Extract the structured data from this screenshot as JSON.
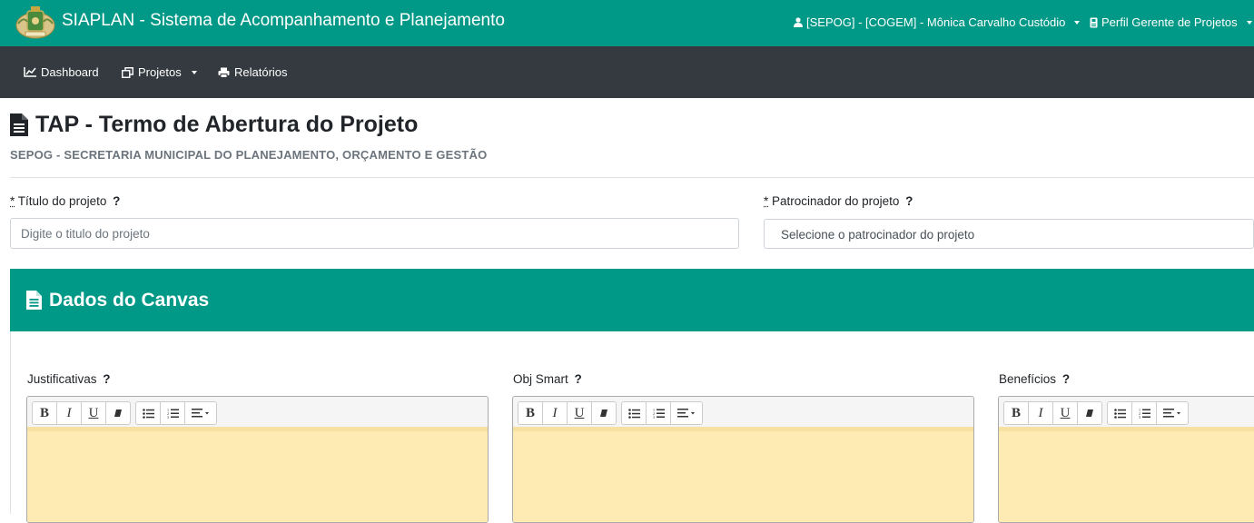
{
  "app": {
    "title": "SIAPLAN - Sistema de Acompanhamento e Planejamento",
    "user": "[SEPOG] - [COGEM] - Mônica Carvalho Custódio",
    "profile": "Perfil Gerente de Projetos"
  },
  "nav": {
    "dashboard": "Dashboard",
    "projetos": "Projetos",
    "relatorios": "Relatórios"
  },
  "page": {
    "title": "TAP - Termo de Abertura do Projeto",
    "subtitle": "SEPOG - SECRETARIA MUNICIPAL DO PLANEJAMENTO, ORÇAMENTO E GESTÃO"
  },
  "form": {
    "titulo": {
      "required_mark": "*",
      "label": "Título do projeto",
      "help": "?",
      "placeholder": "Digite o titulo do projeto",
      "value": ""
    },
    "patrocinador": {
      "required_mark": "*",
      "label": "Patrocinador do projeto",
      "help": "?",
      "selected": "Selecione o patrocinador do projeto"
    }
  },
  "card": {
    "title": "Dados do Canvas",
    "editors": [
      {
        "label": "Justificativas",
        "help": "?"
      },
      {
        "label": "Obj Smart",
        "help": "?"
      },
      {
        "label": "Benefícios",
        "help": "?"
      }
    ]
  },
  "toolbar": {
    "bold": "B",
    "italic": "I",
    "underline": "U"
  },
  "colors": {
    "primary": "#009886",
    "navbar": "#343a40",
    "editor_bg": "#feebb4"
  }
}
